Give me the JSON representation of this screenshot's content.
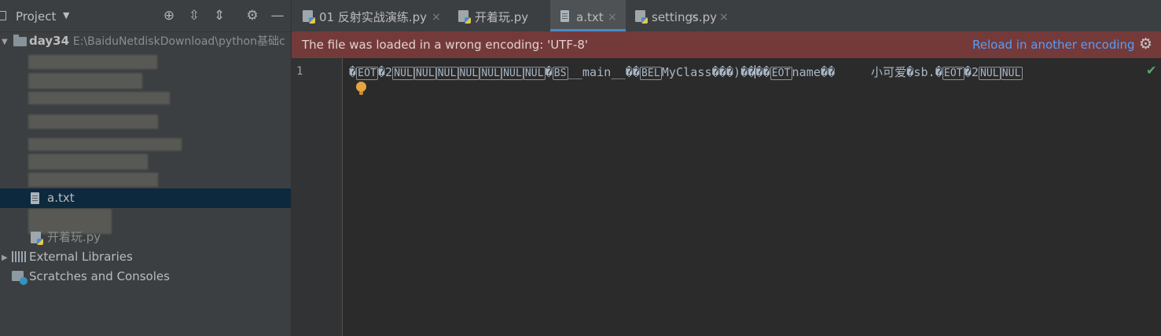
{
  "project_panel": {
    "title": "Project",
    "tree": {
      "root_name": "day34",
      "root_path": "E:\\BaiduNetdiskDownload\\python基础c",
      "selected_file": "a.txt",
      "partial_file": "开着玩.py",
      "external_libraries": "External Libraries",
      "scratches": "Scratches and Consoles"
    }
  },
  "tabs": [
    {
      "label": "01 反射实战演练.py",
      "icon": "python-file-icon",
      "active": false
    },
    {
      "label": "开着玩.py",
      "icon": "python-file-icon",
      "active": false
    },
    {
      "label": "a.txt",
      "icon": "text-file-icon",
      "active": true
    },
    {
      "label": "settings.py",
      "icon": "python-file-icon",
      "active": false
    }
  ],
  "tab_close_glyph": "×",
  "banner": {
    "message": "The file was loaded in a wrong encoding: 'UTF-8'",
    "action": "Reload in another encoding"
  },
  "editor": {
    "line_number": "1",
    "segments": {
      "s1": "�",
      "s2": "EOT",
      "s3": "�2",
      "s4": "NUL",
      "s5": "NUL",
      "s6": "NUL",
      "s7": "NUL",
      "s8": "NUL",
      "s9": "NUL",
      "s10": "NUL",
      "s11": "�",
      "s12": "BS",
      "s13": "__main__��",
      "s14": "BEL",
      "s15": "MyClass���)��",
      "s16": "��",
      "s17": "EOT",
      "s18": "name��     小可爱�sb.�",
      "s19": "EOT",
      "s20": "�2",
      "s21": "NUL",
      "s22": "NUL"
    }
  },
  "colors": {
    "banner_bg": "#743a3a",
    "link": "#589df6",
    "selection": "#0d293e",
    "active_tab_underline": "#4a88c7"
  }
}
